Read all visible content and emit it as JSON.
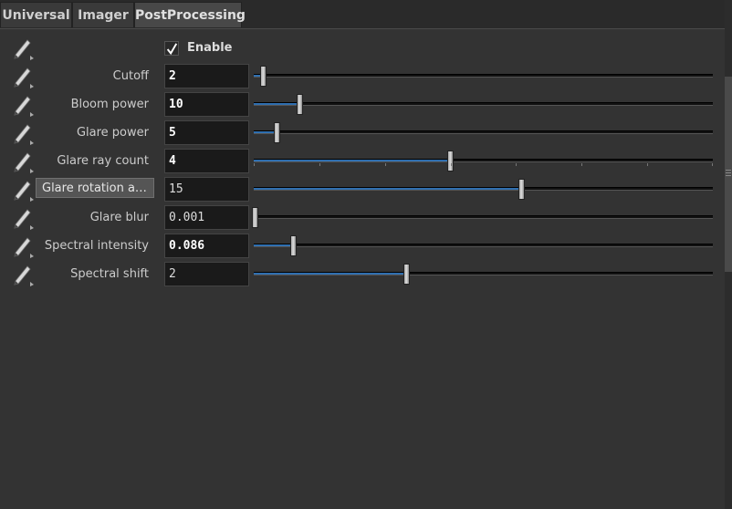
{
  "tabs": [
    {
      "label": "Universal"
    },
    {
      "label": "Imager"
    },
    {
      "label": "PostProcessing"
    }
  ],
  "enable": {
    "label": "Enable",
    "checked": true
  },
  "params": [
    {
      "label": "Cutoff",
      "value": "2",
      "bold": true,
      "fraction": 0.02,
      "highlight": false,
      "ticks": false
    },
    {
      "label": "Bloom power",
      "value": "10",
      "bold": true,
      "fraction": 0.1,
      "highlight": false,
      "ticks": false
    },
    {
      "label": "Glare power",
      "value": "5",
      "bold": true,
      "fraction": 0.05,
      "highlight": false,
      "ticks": false
    },
    {
      "label": "Glare ray count",
      "value": "4",
      "bold": true,
      "fraction": 0.428,
      "highlight": false,
      "ticks": true
    },
    {
      "label": "Glare rotation an...",
      "value": "15",
      "bold": false,
      "fraction": 0.583,
      "highlight": true,
      "ticks": false
    },
    {
      "label": "Glare blur",
      "value": "0.001",
      "bold": false,
      "fraction": 0.0,
      "highlight": false,
      "ticks": false
    },
    {
      "label": "Spectral intensity",
      "value": "0.086",
      "bold": true,
      "fraction": 0.086,
      "highlight": false,
      "ticks": false
    },
    {
      "label": "Spectral shift",
      "value": "2",
      "bold": false,
      "fraction": 0.333,
      "highlight": false,
      "ticks": false
    }
  ],
  "colors": {
    "accent": "#2f6fb0",
    "background": "#333333"
  }
}
